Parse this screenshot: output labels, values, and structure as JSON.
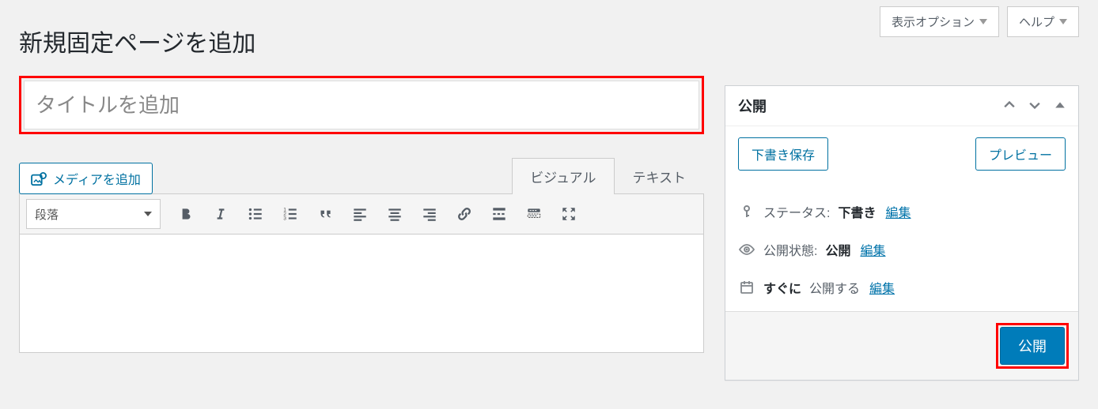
{
  "topbar": {
    "display_options": "表示オプション",
    "help": "ヘルプ"
  },
  "page_title": "新規固定ページを追加",
  "title_input": {
    "value": "",
    "placeholder": "タイトルを追加"
  },
  "editor": {
    "add_media": "メディアを追加",
    "tabs": {
      "visual": "ビジュアル",
      "text": "テキスト"
    },
    "format_select": "段落",
    "toolbar_buttons": [
      "bold",
      "italic",
      "bulleted-list",
      "numbered-list",
      "blockquote",
      "align-left",
      "align-center",
      "align-right",
      "link",
      "read-more",
      "toolbar-toggle",
      "fullscreen"
    ]
  },
  "publish_box": {
    "title": "公開",
    "save_draft": "下書き保存",
    "preview": "プレビュー",
    "status": {
      "label": "ステータス:",
      "value": "下書き",
      "edit": "編集"
    },
    "visibility": {
      "label": "公開状態:",
      "value": "公開",
      "edit": "編集"
    },
    "schedule": {
      "prefix": "すぐに",
      "suffix": "公開する",
      "edit": "編集"
    },
    "publish_button": "公開"
  }
}
